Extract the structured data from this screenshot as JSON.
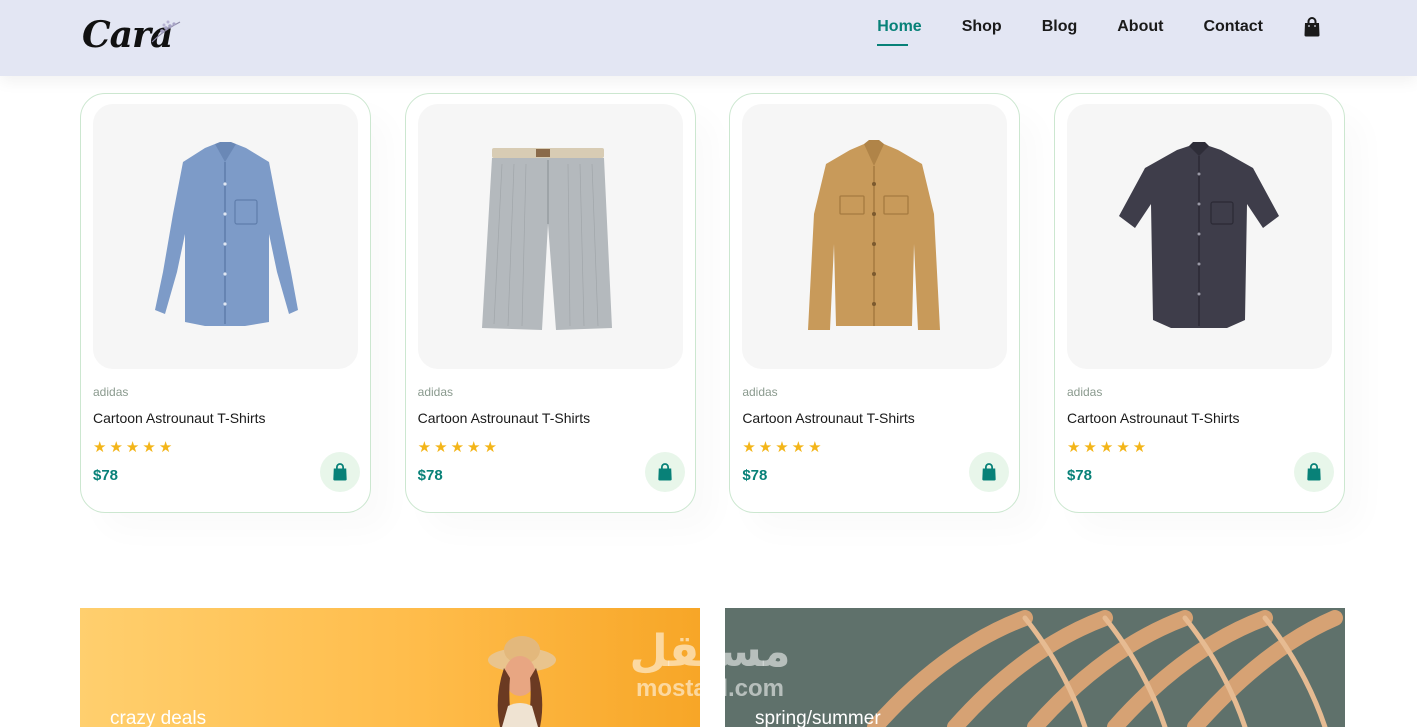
{
  "header": {
    "logo_text": "Cara",
    "nav": [
      "Home",
      "Shop",
      "Blog",
      "About",
      "Contact"
    ],
    "active_nav": "Home",
    "cart_icon": "shopping-bag-icon"
  },
  "products": [
    {
      "brand": "adidas",
      "name": "Cartoon Astrounaut T-Shirts",
      "rating": 5,
      "price": "$78",
      "image": "blue-long-sleeve-shirt",
      "cart_icon": "shopping-bag-icon"
    },
    {
      "brand": "adidas",
      "name": "Cartoon Astrounaut T-Shirts",
      "rating": 5,
      "price": "$78",
      "image": "grey-striped-shorts",
      "cart_icon": "shopping-bag-icon"
    },
    {
      "brand": "adidas",
      "name": "Cartoon Astrounaut T-Shirts",
      "rating": 5,
      "price": "$78",
      "image": "tan-overshirt",
      "cart_icon": "shopping-bag-icon"
    },
    {
      "brand": "adidas",
      "name": "Cartoon Astrounaut T-Shirts",
      "rating": 5,
      "price": "$78",
      "image": "navy-short-sleeve-shirt",
      "cart_icon": "shopping-bag-icon"
    }
  ],
  "banners": [
    {
      "text": "crazy deals"
    },
    {
      "text": "spring/summer"
    }
  ],
  "watermark": {
    "arabic": "مستقل",
    "latin": "mostaql.com"
  },
  "colors": {
    "accent": "#088178",
    "header_bg": "#e3e6f3",
    "star": "#f3b519",
    "card_border": "#cce7d0"
  }
}
